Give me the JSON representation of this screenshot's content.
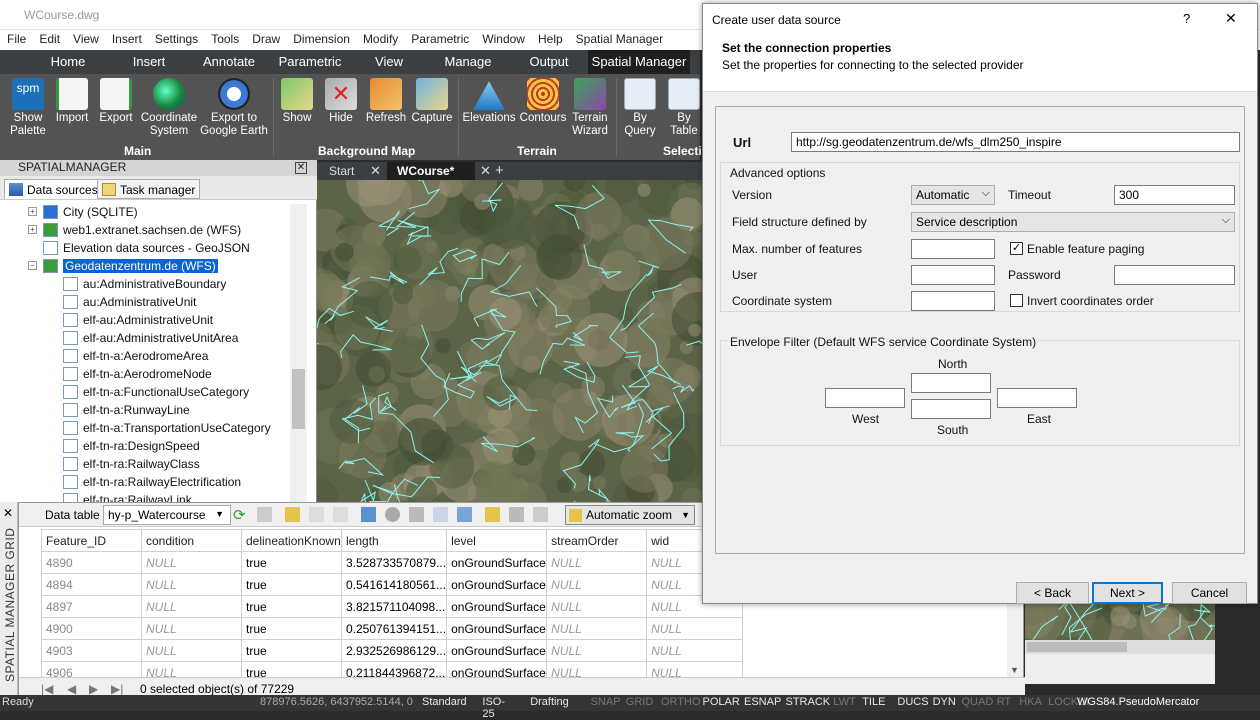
{
  "window": {
    "title": "WCourse.dwg"
  },
  "menu": [
    "File",
    "Edit",
    "View",
    "Insert",
    "Settings",
    "Tools",
    "Draw",
    "Dimension",
    "Modify",
    "Parametric",
    "Window",
    "Help",
    "Spatial Manager"
  ],
  "ribbon_tabs": [
    "Home",
    "Insert",
    "Annotate",
    "Parametric",
    "View",
    "Manage",
    "Output",
    "Spatial Manager"
  ],
  "ribbon": {
    "main": {
      "label": "Main",
      "buttons": [
        [
          "Show",
          "Palette"
        ],
        [
          "Import",
          ""
        ],
        [
          "Export",
          ""
        ],
        [
          "Coordinate",
          "System"
        ],
        [
          "Export to",
          "Google Earth"
        ]
      ]
    },
    "background": {
      "label": "Background Map",
      "buttons": [
        "Show",
        "Hide",
        "Refresh",
        "Capture"
      ]
    },
    "terrain": {
      "label": "Terrain",
      "buttons": [
        [
          "Elevations",
          ""
        ],
        [
          "Contours",
          ""
        ],
        [
          "Terrain",
          "Wizard"
        ]
      ]
    },
    "selection": {
      "label": "Selectio",
      "buttons": [
        [
          "By",
          "Query"
        ],
        [
          "By",
          "Table"
        ]
      ]
    }
  },
  "panel": {
    "title": "SPATIALMANAGER",
    "tabs": [
      "Data sources",
      "Task manager"
    ]
  },
  "tree": [
    "City (SQLITE)",
    "web1.extranet.sachsen.de (WFS)",
    "Elevation data sources - GeoJSON",
    "Geodatenzentrum.de (WFS)",
    "au:AdministrativeBoundary",
    "au:AdministrativeUnit",
    "elf-au:AdministrativeUnit",
    "elf-au:AdministrativeUnitArea",
    "elf-tn-a:AerodromeArea",
    "elf-tn-a:AerodromeNode",
    "elf-tn-a:FunctionalUseCategory",
    "elf-tn-a:RunwayLine",
    "elf-tn-a:TransportationUseCategory",
    "elf-tn-ra:DesignSpeed",
    "elf-tn-ra:RailwayClass",
    "elf-tn-ra:RailwayElectrification",
    "elf-tn-ra:RailwayLink"
  ],
  "doc_tabs": [
    "Start",
    "WCourse*"
  ],
  "grid": {
    "side_title": "SPATIAL MANAGER GRID",
    "label": "Data table",
    "table_select": "hy-p_Watercourse",
    "zoom": "Automatic zoom",
    "columns": [
      "Feature_ID",
      "condition",
      "delineationKnown",
      "length",
      "level",
      "streamOrder",
      "wid"
    ],
    "rows": [
      [
        "4890",
        "NULL",
        "true",
        "3.528733570879...",
        "onGroundSurface",
        "NULL",
        "NULL"
      ],
      [
        "4894",
        "NULL",
        "true",
        "0.541614180561...",
        "onGroundSurface",
        "NULL",
        "NULL"
      ],
      [
        "4897",
        "NULL",
        "true",
        "3.821571104098...",
        "onGroundSurface",
        "NULL",
        "NULL"
      ],
      [
        "4900",
        "NULL",
        "true",
        "0.250761394151...",
        "onGroundSurface",
        "NULL",
        "NULL"
      ],
      [
        "4903",
        "NULL",
        "true",
        "2.932526986129...",
        "onGroundSurface",
        "NULL",
        "NULL"
      ],
      [
        "4906",
        "NULL",
        "true",
        "0.211844396872...",
        "onGroundSurface",
        "NULL",
        "NULL"
      ]
    ],
    "footer": "0 selected object(s) of 77229"
  },
  "status": {
    "ready": "Ready",
    "coords": "878976.5626, 6437952.5144, 0",
    "items": [
      "Standard",
      "ISO-25",
      "Drafting",
      "SNAP",
      "GRID",
      "ORTHO",
      "POLAR",
      "ESNAP",
      "STRACK",
      "LWT",
      "TILE",
      "DUCS",
      "DYN",
      "QUAD",
      "RT",
      "HKA",
      "LOCKUI"
    ],
    "crs": "WGS84.PseudoMercator"
  },
  "dialog": {
    "title": "Create user data source",
    "help": "?",
    "close": "✕",
    "heading": "Set the connection properties",
    "subheading": "Set the properties for connecting to the selected provider",
    "url_label": "Url",
    "url": "http://sg.geodatenzentrum.de/wfs_dlm250_inspire",
    "advanced": "Advanced options",
    "version_label": "Version",
    "version": "Automatic",
    "timeout_label": "Timeout",
    "timeout": "300",
    "field_label": "Field structure defined by",
    "field": "Service description",
    "maxf_label": "Max. number of features",
    "paging_label": "Enable feature paging",
    "user_label": "User",
    "password_label": "Password",
    "crs_label": "Coordinate system",
    "invert_label": "Invert coordinates order",
    "envelope": "Envelope Filter (Default WFS service Coordinate System)",
    "north": "North",
    "west": "West",
    "east": "East",
    "south": "South",
    "back": "< Back",
    "next": "Next >",
    "cancel": "Cancel"
  }
}
